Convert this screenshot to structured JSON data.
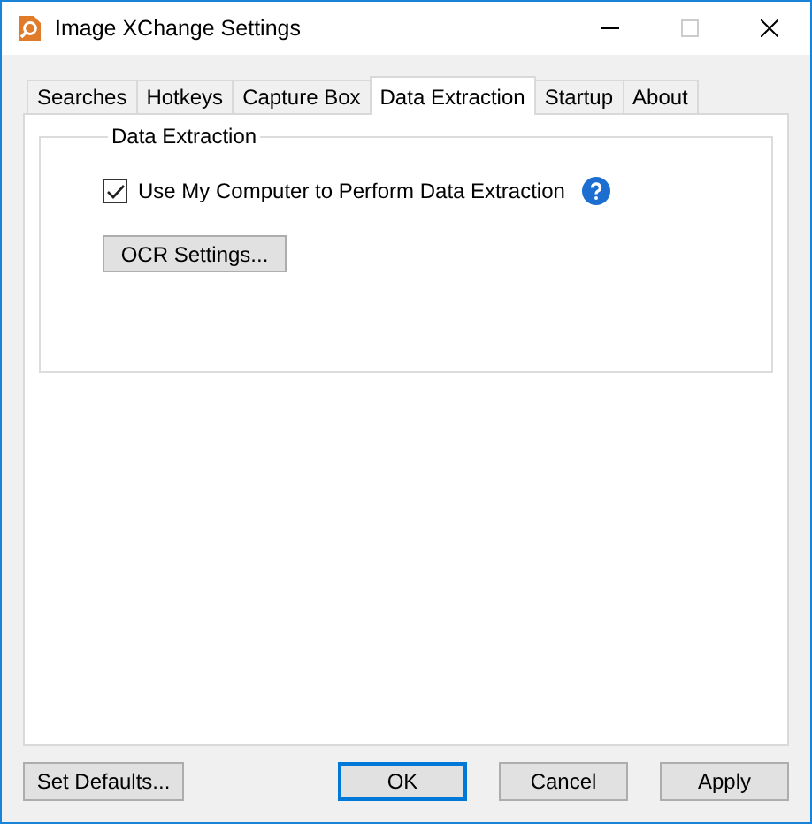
{
  "window": {
    "title": "Image XChange Settings"
  },
  "tabs": [
    {
      "label": "Searches",
      "selected": false
    },
    {
      "label": "Hotkeys",
      "selected": false
    },
    {
      "label": "Capture Box",
      "selected": false
    },
    {
      "label": "Data Extraction",
      "selected": true
    },
    {
      "label": "Startup",
      "selected": false
    },
    {
      "label": "About",
      "selected": false
    }
  ],
  "group": {
    "title": "Data Extraction",
    "checkbox": {
      "label": "Use My Computer to Perform Data Extraction",
      "checked": true
    },
    "button": "OCR Settings..."
  },
  "buttons": [
    {
      "label": "Set Defaults...",
      "default": false
    },
    {
      "label": "OK",
      "default": true
    },
    {
      "label": "Cancel",
      "default": false
    },
    {
      "label": "Apply",
      "default": false
    }
  ]
}
